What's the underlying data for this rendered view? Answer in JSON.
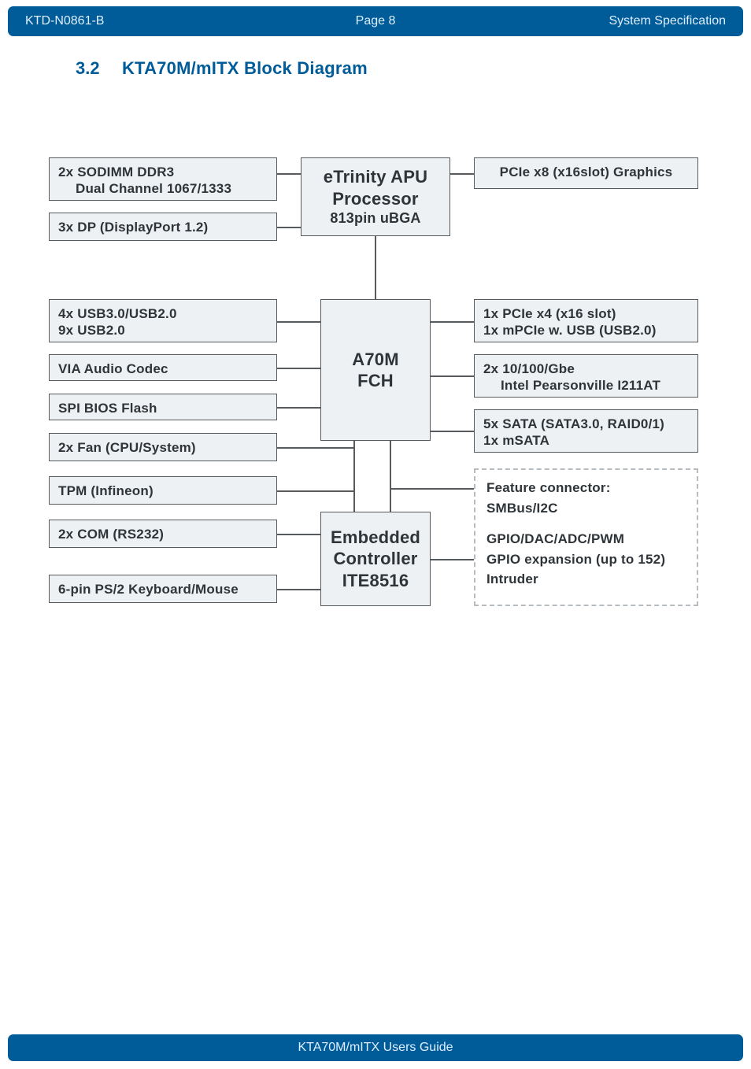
{
  "header": {
    "doc_code": "KTD-N0861-B",
    "page_label": "Page 8",
    "section": "System Specification"
  },
  "heading": {
    "number": "3.2",
    "title": "KTA70M/mITX Block Diagram"
  },
  "blocks": {
    "sodimm_l1": "2x SODIMM DDR3",
    "sodimm_l2": "Dual Channel 1067/1333",
    "dp": "3x DP (DisplayPort 1.2)",
    "apu_l1": "eTrinity APU",
    "apu_l2": "Processor",
    "apu_l3": "813pin uBGA",
    "pcie_gfx": "PCIe x8 (x16slot) Graphics",
    "usb_l1": "4x USB3.0/USB2.0",
    "usb_l2": "9x USB2.0",
    "audio": "VIA Audio Codec",
    "spi": "SPI BIOS Flash",
    "fan": "2x Fan (CPU/System)",
    "fch_l1": "A70M",
    "fch_l2": "FCH",
    "pcie_l1": "1x PCIe x4 (x16 slot)",
    "pcie_l2": "1x mPCIe w. USB (USB2.0)",
    "lan_l1": "2x 10/100/Gbe",
    "lan_l2": "Intel Pearsonville I211AT",
    "sata_l1": "5x SATA (SATA3.0, RAID0/1)",
    "sata_l2": "1x mSATA",
    "tpm": "TPM (Infineon)",
    "com": "2x COM (RS232)",
    "ps2": "6-pin PS/2 Keyboard/Mouse",
    "ec_l1": "Embedded",
    "ec_l2": "Controller",
    "ec_l3": "ITE8516",
    "feat_l1": "Feature connector:",
    "feat_l2": "SMBus/I2C",
    "feat_l3": " ",
    "feat_l4": "GPIO/DAC/ADC/PWM",
    "feat_l5": "GPIO expansion (up to 152)",
    "feat_l6": "Intruder"
  },
  "footer": {
    "title": "KTA70M/mITX Users Guide"
  }
}
